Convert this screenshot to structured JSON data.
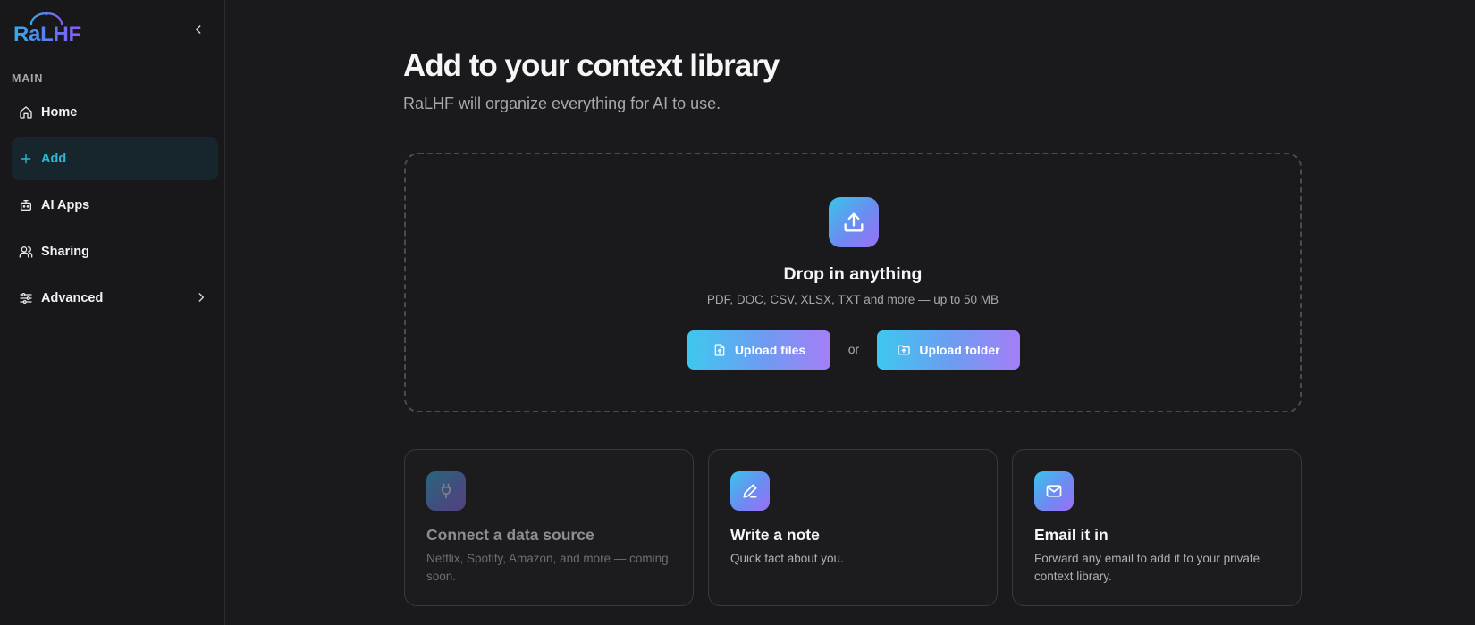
{
  "app": {
    "logo_text": "RaLHF",
    "colors": {
      "accent": "#2bb7d6",
      "gradient_start": "#3ec8ee",
      "gradient_end": "#a57ef6",
      "background": "#1a1a1c",
      "sidebar_background": "#18181a",
      "active_item_background": "#16262c"
    }
  },
  "sidebar": {
    "section_label": "MAIN",
    "items": [
      {
        "label": "Home",
        "icon": "home-icon",
        "active": false
      },
      {
        "label": "Add",
        "icon": "plus-icon",
        "active": true
      },
      {
        "label": "AI Apps",
        "icon": "bot-icon",
        "active": false
      },
      {
        "label": "Sharing",
        "icon": "users-icon",
        "active": false
      },
      {
        "label": "Advanced",
        "icon": "sliders-icon",
        "active": false,
        "has_submenu": true
      }
    ]
  },
  "main": {
    "title": "Add to your context library",
    "subtitle": "RaLHF will organize everything for AI to use.",
    "dropzone": {
      "title": "Drop in anything",
      "subtitle": "PDF, DOC, CSV, XLSX, TXT and more — up to 50 MB",
      "upload_files_label": "Upload files",
      "or_label": "or",
      "upload_folder_label": "Upload folder"
    },
    "cards": [
      {
        "title": "Connect a data source",
        "description": "Netflix, Spotify, Amazon, and more — coming soon.",
        "icon": "plug-icon",
        "disabled": true
      },
      {
        "title": "Write a note",
        "description": "Quick fact about you.",
        "icon": "pencil-icon",
        "disabled": false
      },
      {
        "title": "Email it in",
        "description": "Forward any email to add it to your private context library.",
        "icon": "mail-icon",
        "disabled": false
      }
    ]
  }
}
